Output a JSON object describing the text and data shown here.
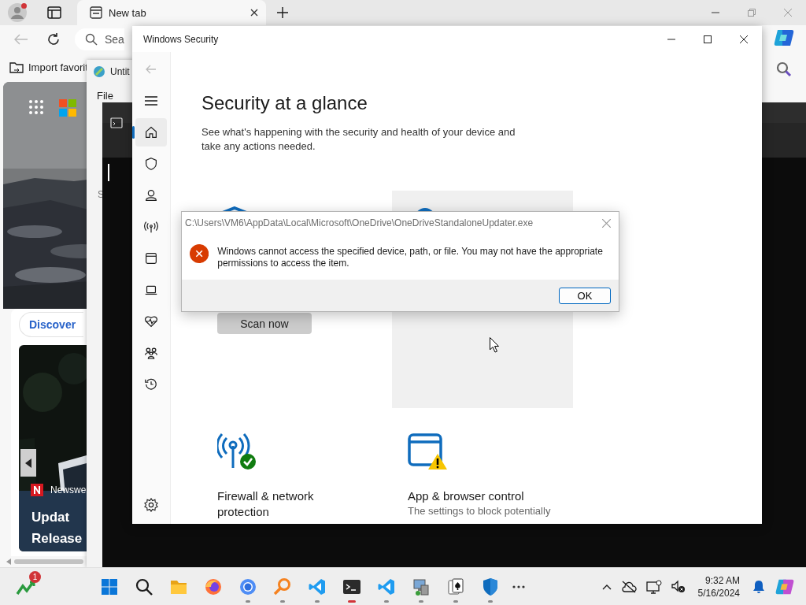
{
  "browser": {
    "profile": {
      "notification": true
    },
    "tabs": [
      {
        "label": "New tab",
        "selected": true
      }
    ],
    "address": {
      "placeholder": "Sea"
    },
    "favorites": [
      {
        "label": "Import favorit"
      }
    ],
    "feed": {
      "tabs": [
        {
          "label": "Discover",
          "selected": true
        }
      ],
      "story": {
        "source": "Newswe",
        "headline_lines": [
          "Updat",
          "Release"
        ]
      }
    }
  },
  "notepad": {
    "title": "Untit",
    "menu": [
      {
        "label": "File"
      }
    ],
    "text": "S"
  },
  "security": {
    "title": "Windows Security",
    "nav": [
      {
        "kind": "home",
        "selected": true
      },
      {
        "kind": "shield",
        "selected": false
      },
      {
        "kind": "person",
        "selected": false
      },
      {
        "kind": "antenna",
        "selected": false
      },
      {
        "kind": "window",
        "selected": false
      },
      {
        "kind": "laptop",
        "selected": false
      },
      {
        "kind": "heart",
        "selected": false
      },
      {
        "kind": "family",
        "selected": false
      },
      {
        "kind": "history",
        "selected": false
      }
    ],
    "heading": "Security at a glance",
    "subtitle": "See what's happening with the security and health of your device and take any actions needed.",
    "cards": [
      {
        "kind": "virus",
        "highlighted": false,
        "button": "Scan now"
      },
      {
        "kind": "account",
        "highlighted": true
      },
      {
        "kind": "firewall",
        "highlighted": false,
        "title": "Firewall & network protection",
        "warning": false
      },
      {
        "kind": "app",
        "highlighted": false,
        "title": "App & browser control",
        "status": "The settings to block potentially",
        "warning": true
      }
    ]
  },
  "dialog": {
    "kind": "error",
    "title": "C:\\Users\\VM6\\AppData\\Local\\Microsoft\\OneDrive\\OneDriveStandaloneUpdater.exe",
    "message": "Windows cannot access the specified device, path, or file. You may not have the appropriate permissions to access the item.",
    "buttons": [
      {
        "label": "OK",
        "default": true
      }
    ]
  },
  "taskbar": {
    "widget": {
      "badge": "1"
    },
    "apps": [
      {
        "kind": "start",
        "running": false,
        "active": false
      },
      {
        "kind": "search",
        "running": false,
        "active": false
      },
      {
        "kind": "explorer",
        "running": false,
        "active": false
      },
      {
        "kind": "firefox",
        "running": false,
        "active": false
      },
      {
        "kind": "chrome",
        "running": true,
        "active": false
      },
      {
        "kind": "magnifier",
        "running": true,
        "active": false
      },
      {
        "kind": "vscode",
        "running": true,
        "active": false
      },
      {
        "kind": "terminal",
        "running": true,
        "active": true
      },
      {
        "kind": "vscode",
        "running": true,
        "active": false
      },
      {
        "kind": "computer",
        "running": true,
        "active": false
      },
      {
        "kind": "solitaire",
        "running": true,
        "active": false
      },
      {
        "kind": "defender",
        "running": true,
        "active": false
      }
    ],
    "time": "9:32 AM",
    "date": "5/16/2024"
  }
}
